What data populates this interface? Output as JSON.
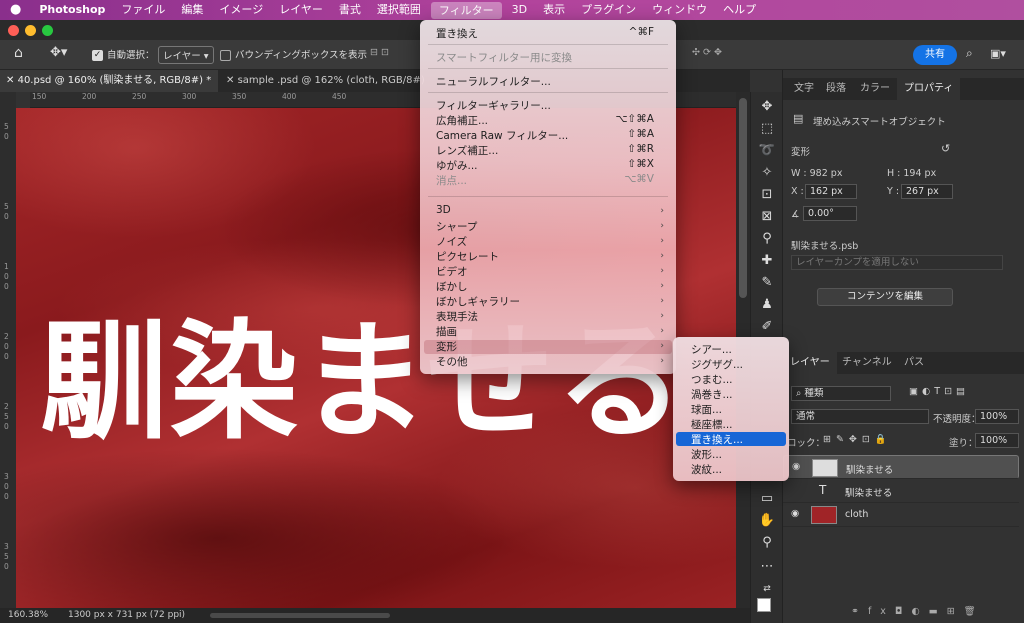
{
  "menubar": {
    "app": "Photoshop",
    "items": [
      "ファイル",
      "編集",
      "イメージ",
      "レイヤー",
      "書式",
      "選択範囲",
      "フィルター",
      "3D",
      "表示",
      "プラグイン",
      "ウィンドウ",
      "ヘルプ"
    ]
  },
  "options": {
    "auto_select": "自動選択：",
    "layer_select": "レイヤー",
    "bbox": "バウンディングボックスを表示",
    "share": "共有"
  },
  "tabs": [
    {
      "label": "40.psd @ 160% (馴染ませる, RGB/8#) *"
    },
    {
      "label": "sample .psd @ 162% (cloth, RGB/8#)"
    }
  ],
  "ruler_h": [
    "150",
    "200",
    "250",
    "300",
    "350",
    "400",
    "450"
  ],
  "ruler_v": [
    "5",
    "0",
    "5",
    "0",
    "1",
    "0",
    "0",
    "2",
    "0",
    "0",
    "2",
    "5",
    "0",
    "3",
    "0",
    "0",
    "3",
    "5",
    "0"
  ],
  "canvas": {
    "text": "馴染ませる"
  },
  "status": {
    "zoom": "160.38%",
    "size": "1300 px x 731 px (72 ppi)"
  },
  "filter_menu": {
    "items": [
      {
        "label": "置き換え",
        "shortcut": "^⌘F",
        "disabled": false
      },
      {
        "label": "スマートフィルター用に変換",
        "shortcut": "",
        "disabled": true
      },
      {
        "label": "ニューラルフィルター...",
        "shortcut": "",
        "disabled": false
      },
      {
        "label": "フィルターギャラリー...",
        "shortcut": "",
        "disabled": false
      },
      {
        "label": "広角補正...",
        "shortcut": "⌥⇧⌘A",
        "disabled": false
      },
      {
        "label": "Camera Raw フィルター...",
        "shortcut": "⇧⌘A",
        "disabled": false
      },
      {
        "label": "レンズ補正...",
        "shortcut": "⇧⌘R",
        "disabled": false
      },
      {
        "label": "ゆがみ...",
        "shortcut": "⇧⌘X",
        "disabled": false
      },
      {
        "label": "消点...",
        "shortcut": "⌥⌘V",
        "disabled": true
      },
      {
        "label": "3D",
        "shortcut": "",
        "disabled": false
      },
      {
        "label": "シャープ",
        "shortcut": "",
        "disabled": false
      },
      {
        "label": "ノイズ",
        "shortcut": "",
        "disabled": false
      },
      {
        "label": "ピクセレート",
        "shortcut": "",
        "disabled": false
      },
      {
        "label": "ビデオ",
        "shortcut": "",
        "disabled": false
      },
      {
        "label": "ぼかし",
        "shortcut": "",
        "disabled": false
      },
      {
        "label": "ぼかしギャラリー",
        "shortcut": "",
        "disabled": false
      },
      {
        "label": "表現手法",
        "shortcut": "",
        "disabled": false
      },
      {
        "label": "描画",
        "shortcut": "",
        "disabled": false
      },
      {
        "label": "変形",
        "shortcut": "",
        "disabled": false
      },
      {
        "label": "その他",
        "shortcut": "",
        "disabled": false
      }
    ]
  },
  "distort_submenu": [
    "シアー...",
    "ジグザグ...",
    "つまむ...",
    "渦巻き...",
    "球面...",
    "極座標...",
    "置き換え...",
    "波形...",
    "波紋..."
  ],
  "properties": {
    "tabs": [
      "文字",
      "段落",
      "カラー",
      "プロパティ"
    ],
    "kind": "埋め込みスマートオブジェクト",
    "transform": "変形",
    "w": "W : 982 px",
    "h": "H : 194 px",
    "x_label": "X :",
    "x": "162 px",
    "y_label": "Y :",
    "y": "267 px",
    "angle": "0.00°",
    "file": "馴染ませる.psb",
    "comp": "レイヤーカンプを適用しない",
    "edit_button": "コンテンツを編集"
  },
  "layers": {
    "tabs": [
      "レイヤー",
      "チャンネル",
      "パス"
    ],
    "filter": "種類",
    "blend": "通常",
    "opacity_label": "不透明度：",
    "opacity": "100%",
    "lock_label": "ロック：",
    "fill_label": "塗り：",
    "fill": "100%",
    "rows": [
      {
        "name": "馴染ませる"
      },
      {
        "name": "馴染ませる"
      },
      {
        "name": "cloth"
      }
    ]
  },
  "icon_names": [
    "apple-icon",
    "home-icon",
    "move-icon",
    "search-icon",
    "visibility-eye-icon"
  ]
}
